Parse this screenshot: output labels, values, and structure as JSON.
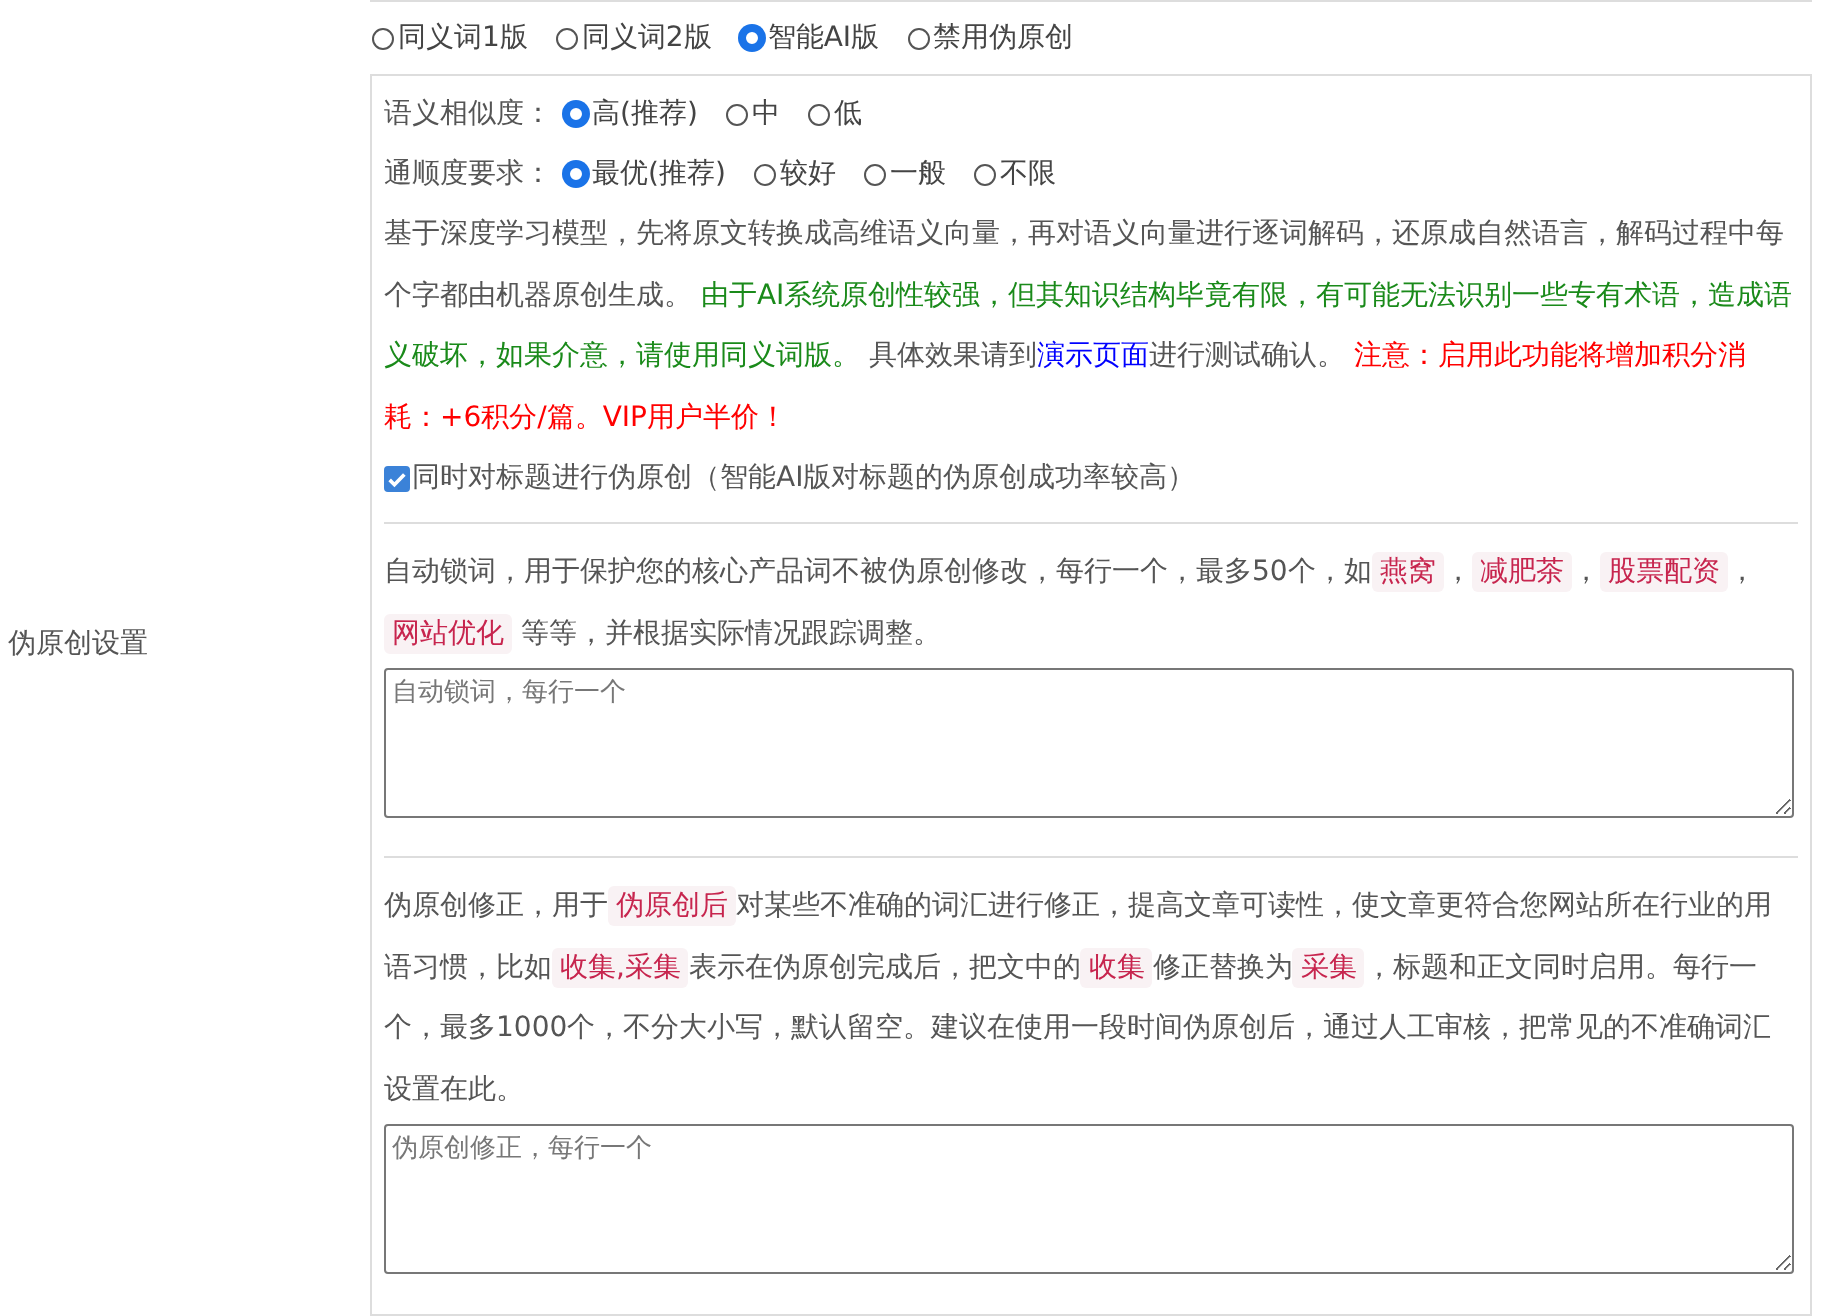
{
  "version_options": [
    {
      "label": "同义词1版",
      "selected": false
    },
    {
      "label": "同义词2版",
      "selected": false
    },
    {
      "label": "智能AI版",
      "selected": true
    },
    {
      "label": "禁用伪原创",
      "selected": false
    }
  ],
  "settings_label": "伪原创设置",
  "similarity": {
    "label": "语义相似度：",
    "options": [
      {
        "label": "高(推荐)",
        "selected": true
      },
      {
        "label": "中",
        "selected": false
      },
      {
        "label": "低",
        "selected": false
      }
    ]
  },
  "fluency": {
    "label": "通顺度要求：",
    "options": [
      {
        "label": "最优(推荐)",
        "selected": true
      },
      {
        "label": "较好",
        "selected": false
      },
      {
        "label": "一般",
        "selected": false
      },
      {
        "label": "不限",
        "selected": false
      }
    ]
  },
  "description": [
    {
      "kind": "plain",
      "text": "基于深度学习模型，先将原文转换成高维语义向量，再对语义向量进行逐词解码，还原成自然语言，解码过程中每个字都由机器原创生成。 "
    },
    {
      "kind": "warning",
      "text": "由于AI系统原创性较强，但其知识结构毕竟有限，有可能无法识别一些专有术语，造成语义破坏，如果介意，请使用同义词版。"
    },
    {
      "kind": "plain",
      "text": " 具体效果请到"
    },
    {
      "kind": "link",
      "text": "演示页面"
    },
    {
      "kind": "plain",
      "text": "进行测试确认。 "
    },
    {
      "kind": "alert",
      "text": "注意：启用此功能将增加积分消耗：+6积分/篇。VIP用户半价！"
    }
  ],
  "title_option": {
    "label": "同时对标题进行伪原创（智能AI版对标题的伪原创成功率较高）",
    "checked": true
  },
  "lock_words": {
    "description": [
      {
        "kind": "plain",
        "text": "自动锁词，用于保护您的核心产品词不被伪原创修改，每行一个，最多50个，如"
      },
      {
        "kind": "tag",
        "text": "燕窝"
      },
      {
        "kind": "plain",
        "text": "，"
      },
      {
        "kind": "tag",
        "text": "减肥茶"
      },
      {
        "kind": "plain",
        "text": "，"
      },
      {
        "kind": "tag",
        "text": "股票配资"
      },
      {
        "kind": "plain",
        "text": "，"
      },
      {
        "kind": "tag",
        "text": "网站优化"
      },
      {
        "kind": "plain",
        "text": " 等等，并根据实际情况跟踪调整。"
      }
    ],
    "placeholder": "自动锁词，每行一个"
  },
  "correction": {
    "description": [
      {
        "kind": "plain",
        "text": "伪原创修正，用于"
      },
      {
        "kind": "tag",
        "text": "伪原创后"
      },
      {
        "kind": "plain",
        "text": "对某些不准确的词汇进行修正，提高文章可读性，使文章更符合您网站所在行业的用语习惯，比如"
      },
      {
        "kind": "tag",
        "text": "收集,采集"
      },
      {
        "kind": "plain",
        "text": "表示在伪原创完成后，把文中的"
      },
      {
        "kind": "tag",
        "text": "收集"
      },
      {
        "kind": "plain",
        "text": "修正替换为"
      },
      {
        "kind": "tag",
        "text": "采集"
      },
      {
        "kind": "plain",
        "text": "，标题和正文同时启用。每行一个，最多1000个，不分大小写，默认留空。建议在使用一段时间伪原创后，通过人工审核，把常见的不准确词汇设置在此。"
      }
    ],
    "placeholder": "伪原创修正，每行一个"
  }
}
